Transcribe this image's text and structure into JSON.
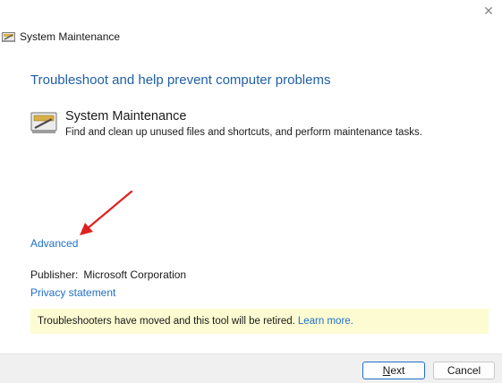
{
  "window": {
    "title": "System Maintenance",
    "close_glyph": "✕"
  },
  "main": {
    "heading": "Troubleshoot and help prevent computer problems",
    "tool": {
      "name": "System Maintenance",
      "description": "Find and clean up unused files and shortcuts, and perform maintenance tasks.",
      "icon": "system-maintenance-icon"
    },
    "advanced_link": "Advanced",
    "publisher_label": "Publisher:",
    "publisher_value": "Microsoft Corporation",
    "privacy_link": "Privacy statement",
    "notice": {
      "text": "Troubleshooters have moved and this tool will be retired.",
      "link": "Learn more."
    },
    "annotation": {
      "icon": "red-arrow",
      "color": "#e02020"
    }
  },
  "footer": {
    "next_first": "N",
    "next_rest": "ext",
    "cancel": "Cancel"
  },
  "colors": {
    "heading": "#1f5fa8",
    "link": "#1f6fc5",
    "notice_bg": "#fdfbd2",
    "footer_bg": "#f0f0f0"
  }
}
